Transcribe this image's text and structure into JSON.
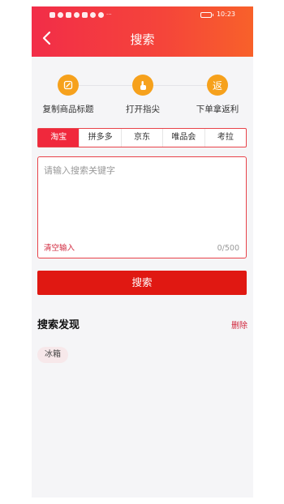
{
  "status_bar": {
    "time": "10:23",
    "dots": "···"
  },
  "header": {
    "title": "搜索"
  },
  "steps": [
    {
      "label": "复制商品标题",
      "icon": "copy-edit-icon"
    },
    {
      "label": "打开指尖",
      "icon": "finger-tap-icon"
    },
    {
      "label": "下单拿返利",
      "icon": "rebate-icon",
      "glyph": "返"
    }
  ],
  "tabs": [
    {
      "label": "淘宝",
      "active": true
    },
    {
      "label": "拼多多",
      "active": false
    },
    {
      "label": "京东",
      "active": false
    },
    {
      "label": "唯品会",
      "active": false
    },
    {
      "label": "考拉",
      "active": false
    }
  ],
  "search_box": {
    "placeholder": "请输入搜索关键字",
    "value": "",
    "clear_label": "清空输入",
    "counter": "0/500"
  },
  "search_button": {
    "label": "搜索"
  },
  "discovery": {
    "title": "搜索发现",
    "delete_label": "删除",
    "tags": [
      "冰箱"
    ]
  },
  "colors": {
    "brand_red": "#f0283c",
    "button_red": "#e01812",
    "step_orange": "#f6a11c"
  }
}
